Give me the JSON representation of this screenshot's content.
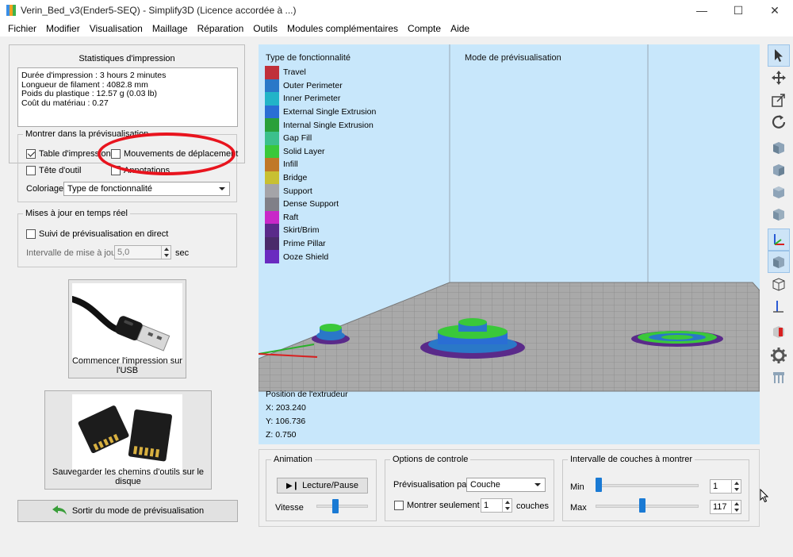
{
  "window": {
    "title": "Verin_Bed_v3(Ender5-SEQ) - Simplify3D (Licence accordée à ...)",
    "minimize": "—",
    "maximize": "☐",
    "close": "✕"
  },
  "menu": [
    "Fichier",
    "Modifier",
    "Visualisation",
    "Maillage",
    "Réparation",
    "Outils",
    "Modules complémentaires",
    "Compte",
    "Aide"
  ],
  "stats": {
    "title": "Statistiques d'impression",
    "lines": [
      "Durée d'impression : 3 hours 2 minutes",
      "Longueur de filament : 4082.8 mm",
      "Poids du plastique : 12.57 g (0.03 lb)",
      "Coût du matériau : 0.27"
    ]
  },
  "show_group": {
    "legend": "Montrer dans la prévisualisation",
    "table_label": "Table d'impression",
    "table_checked": true,
    "travel_label": "Mouvements de déplacement",
    "travel_checked": false,
    "tool_label": "Tête d'outil",
    "tool_checked": false,
    "annotations_label": "Annotations",
    "annotations_checked": false,
    "coloring_label": "Coloriage",
    "coloring_value": "Type de fonctionnalité"
  },
  "live_group": {
    "legend": "Mises à jour en temps réel",
    "follow_label": "Suivi de prévisualisation en direct",
    "follow_checked": false,
    "interval_label": "Intervalle de mise à jour",
    "interval_value": "5,0",
    "interval_unit": "sec"
  },
  "usb_button": {
    "label": "Commencer l'impression sur l'USB"
  },
  "sd_button": {
    "label": "Sauvegarder les chemins d'outils sur le disque"
  },
  "exit_button": {
    "label": "Sortir du mode de prévisualisation"
  },
  "viewport": {
    "legend_title": "Type de fonctionnalité",
    "mode_title": "Mode de prévisualisation",
    "features": [
      {
        "name": "Travel",
        "color": "#c0303a"
      },
      {
        "name": "Outer Perimeter",
        "color": "#2a78c8"
      },
      {
        "name": "Inner Perimeter",
        "color": "#22b4c8"
      },
      {
        "name": "External Single Extrusion",
        "color": "#2a6ed4"
      },
      {
        "name": "Internal Single Extrusion",
        "color": "#2aa03a"
      },
      {
        "name": "Gap Fill",
        "color": "#3cc08c"
      },
      {
        "name": "Solid Layer",
        "color": "#3ac83a"
      },
      {
        "name": "Infill",
        "color": "#c07828"
      },
      {
        "name": "Bridge",
        "color": "#c8c032"
      },
      {
        "name": "Support",
        "color": "#a4a4a8"
      },
      {
        "name": "Dense Support",
        "color": "#808088"
      },
      {
        "name": "Raft",
        "color": "#c828c8"
      },
      {
        "name": "Skirt/Brim",
        "color": "#5a2a8a"
      },
      {
        "name": "Prime Pillar",
        "color": "#4a2a6a"
      },
      {
        "name": "Ooze Shield",
        "color": "#6a2ac0"
      }
    ],
    "extruder_title": "Position de l'extrudeur",
    "x": "X: 203.240",
    "y": "Y: 106.736",
    "z": "Z: 0.750"
  },
  "animation": {
    "legend": "Animation",
    "play_label": "Lecture/Pause",
    "speed_label": "Vitesse",
    "speed_value": 0.35
  },
  "control_options": {
    "legend": "Options de controle",
    "preview_by_label": "Prévisualisation par",
    "preview_by_value": "Couche",
    "only_show_label": "Montrer seulement",
    "only_show_checked": false,
    "only_show_value": "1",
    "layers_unit": "couches"
  },
  "layer_range": {
    "legend": "Intervalle de couches à montrer",
    "min_label": "Min",
    "min_value": "1",
    "max_label": "Max",
    "max_value": "117",
    "total_layers": 117
  },
  "toolbar_icons": [
    "select-arrow-icon",
    "move-icon",
    "scale-icon",
    "rotate-icon",
    "view-front-icon",
    "view-back-icon",
    "view-left-icon",
    "view-right-icon",
    "axes-icon",
    "solid-view-icon",
    "wireframe-view-icon",
    "axis-z-icon",
    "cross-section-icon",
    "settings-gear-icon",
    "support-icon"
  ]
}
